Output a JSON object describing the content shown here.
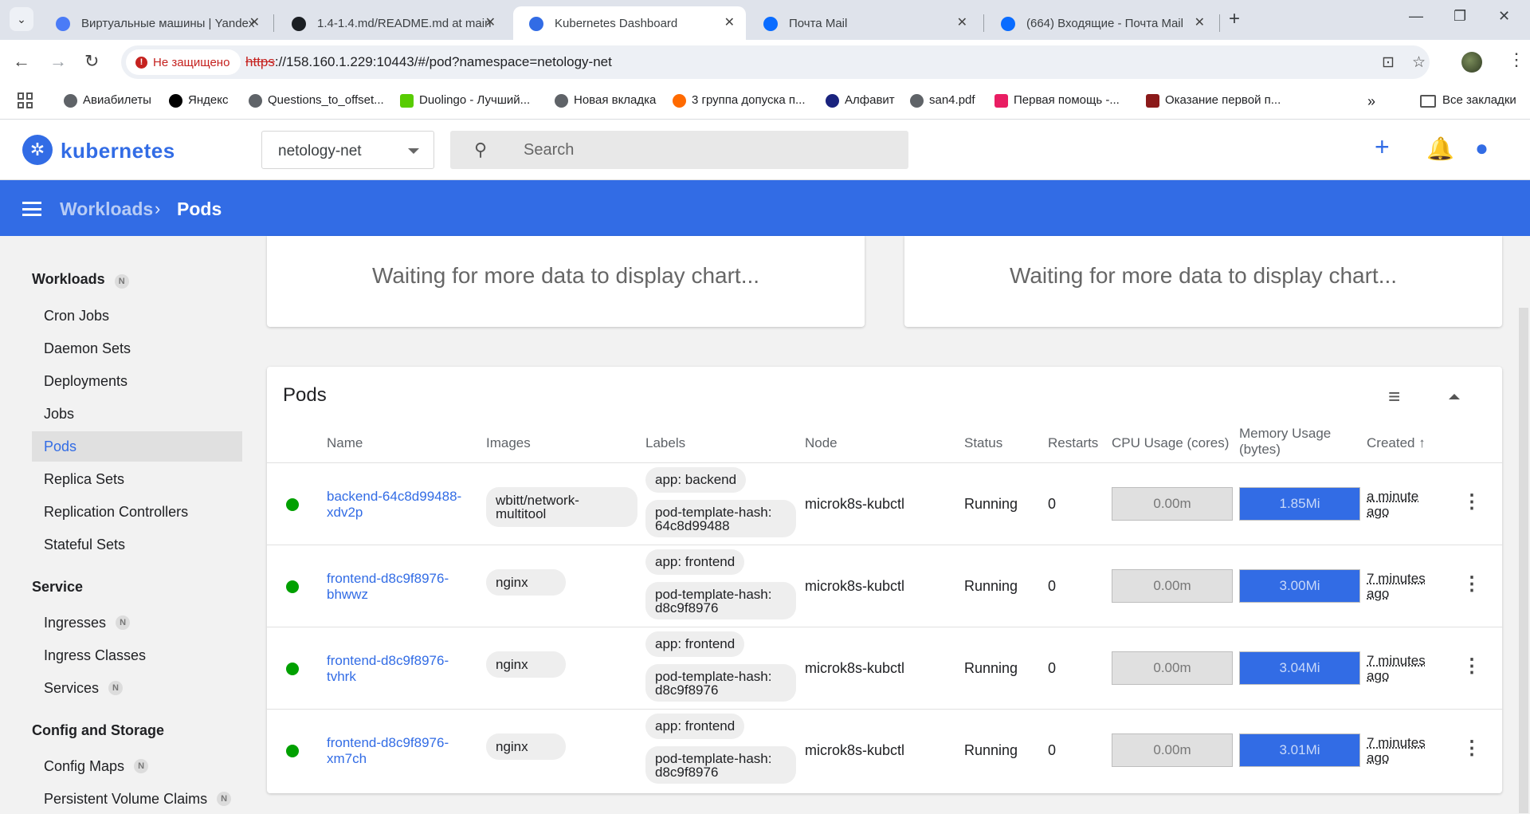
{
  "browser": {
    "tabs": [
      {
        "title": "Виртуальные машины | Yandex",
        "active": false
      },
      {
        "title": "1.4-1.4.md/README.md at main",
        "active": false
      },
      {
        "title": "Kubernetes Dashboard",
        "active": true
      },
      {
        "title": "Почта Mail",
        "active": false
      },
      {
        "title": "(664) Входящие - Почта Mail",
        "active": false
      }
    ],
    "insecure_label": "Не защищено",
    "url_scheme": "https",
    "url_rest": "://158.160.1.229:10443/#/pod?namespace=netology-net",
    "bookmarks": [
      {
        "label": "Авиабилеты",
        "color": "#5f6368"
      },
      {
        "label": "Яндекс",
        "color": "#000000"
      },
      {
        "label": "Questions_to_offset...",
        "color": "#5f6368"
      },
      {
        "label": "Duolingo - Лучший...",
        "color": "#58cc02"
      },
      {
        "label": "Новая вкладка",
        "color": "#5f6368"
      },
      {
        "label": "3 группа допуска п...",
        "color": "#ff6a00"
      },
      {
        "label": "Алфавит",
        "color": "#1a237e"
      },
      {
        "label": "san4.pdf",
        "color": "#5f6368"
      },
      {
        "label": "Первая помощь -...",
        "color": "#e91e63"
      },
      {
        "label": "Оказание первой п...",
        "color": "#8b1a1a"
      }
    ],
    "all_bookmarks": "Все закладки"
  },
  "header": {
    "brand": "kubernetes",
    "namespace": "netology-net",
    "search_placeholder": "Search"
  },
  "breadcrumb": {
    "parent": "Workloads",
    "current": "Pods"
  },
  "sidebar": {
    "workloads_title": "Workloads",
    "workloads_items": [
      "Cron Jobs",
      "Daemon Sets",
      "Deployments",
      "Jobs",
      "Pods",
      "Replica Sets",
      "Replication Controllers",
      "Stateful Sets"
    ],
    "service_title": "Service",
    "service_items": [
      "Ingresses",
      "Ingress Classes",
      "Services"
    ],
    "config_title": "Config and Storage",
    "config_items": [
      "Config Maps",
      "Persistent Volume Claims"
    ],
    "badge": "N"
  },
  "charts": {
    "cpu_message": "Waiting for more data to display chart...",
    "memory_message": "Waiting for more data to display chart..."
  },
  "pods": {
    "title": "Pods",
    "columns": {
      "name": "Name",
      "images": "Images",
      "labels": "Labels",
      "node": "Node",
      "status": "Status",
      "restarts": "Restarts",
      "cpu": "CPU Usage (cores)",
      "memory": "Memory Usage (bytes)",
      "created": "Created"
    },
    "rows": [
      {
        "name": "backend-64c8d99488-xdv2p",
        "image": "wbitt/network-multitool",
        "label1": "app: backend",
        "label2": "pod-template-hash: 64c8d99488",
        "node": "microk8s-kubctl",
        "status": "Running",
        "restarts": "0",
        "cpu": "0.00m",
        "memory": "1.85Mi",
        "memory_fill": 1.0,
        "created": "a minute ago"
      },
      {
        "name": "frontend-d8c9f8976-bhwwz",
        "image": "nginx",
        "label1": "app: frontend",
        "label2": "pod-template-hash: d8c9f8976",
        "node": "microk8s-kubctl",
        "status": "Running",
        "restarts": "0",
        "cpu": "0.00m",
        "memory": "3.00Mi",
        "memory_fill": 1.0,
        "created": "7 minutes ago"
      },
      {
        "name": "frontend-d8c9f8976-tvhrk",
        "image": "nginx",
        "label1": "app: frontend",
        "label2": "pod-template-hash: d8c9f8976",
        "node": "microk8s-kubctl",
        "status": "Running",
        "restarts": "0",
        "cpu": "0.00m",
        "memory": "3.04Mi",
        "memory_fill": 1.0,
        "created": "7 minutes ago"
      },
      {
        "name": "frontend-d8c9f8976-xm7ch",
        "image": "nginx",
        "label1": "app: frontend",
        "label2": "pod-template-hash: d8c9f8976",
        "node": "microk8s-kubctl",
        "status": "Running",
        "restarts": "0",
        "cpu": "0.00m",
        "memory": "3.01Mi",
        "memory_fill": 1.0,
        "created": "7 minutes ago"
      }
    ]
  },
  "colors": {
    "accent": "#326ce5",
    "running": "#00a000",
    "insecure": "#c5221f"
  }
}
